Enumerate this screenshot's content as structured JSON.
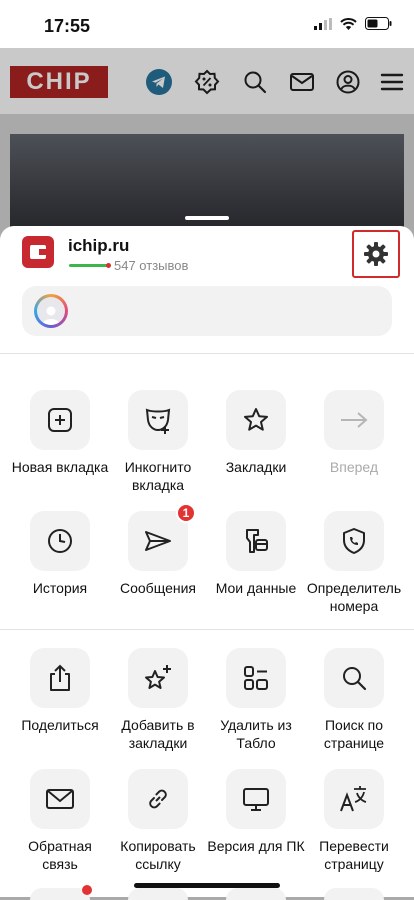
{
  "status_bar": {
    "time": "17:55"
  },
  "site": {
    "logo_text": "CHIP"
  },
  "panel": {
    "site_name": "ichip.ru",
    "reviews": "547 отзывов"
  },
  "menu": [
    {
      "label": "Новая вкладка",
      "icon": "plus-square-icon"
    },
    {
      "label": "Инкогнито вкладка",
      "icon": "incognito-mask-icon"
    },
    {
      "label": "Закладки",
      "icon": "star-icon"
    },
    {
      "label": "Вперед",
      "icon": "arrow-right-icon",
      "disabled": true
    },
    {
      "label": "История",
      "icon": "clock-icon"
    },
    {
      "label": "Сообщения",
      "icon": "paper-plane-icon",
      "badge": "1"
    },
    {
      "label": "Мои данные",
      "icon": "my-data-icon"
    },
    {
      "label": "Определитель номера",
      "icon": "phone-shield-icon"
    },
    {
      "label": "Поделиться",
      "icon": "share-icon"
    },
    {
      "label": "Добавить в закладки",
      "icon": "star-plus-icon"
    },
    {
      "label": "Удалить из Табло",
      "icon": "dashboard-icon"
    },
    {
      "label": "Поиск по странице",
      "icon": "search-icon"
    },
    {
      "label": "Обратная связь",
      "icon": "envelope-icon"
    },
    {
      "label": "Копировать ссылку",
      "icon": "link-icon"
    },
    {
      "label": "Версия для ПК",
      "icon": "monitor-icon"
    },
    {
      "label": "Перевести страницу",
      "icon": "translate-icon"
    }
  ],
  "colors": {
    "accent_red": "#d02a2a",
    "rating_green": "#3fb44b",
    "tile_bg": "#f2f2f2"
  }
}
